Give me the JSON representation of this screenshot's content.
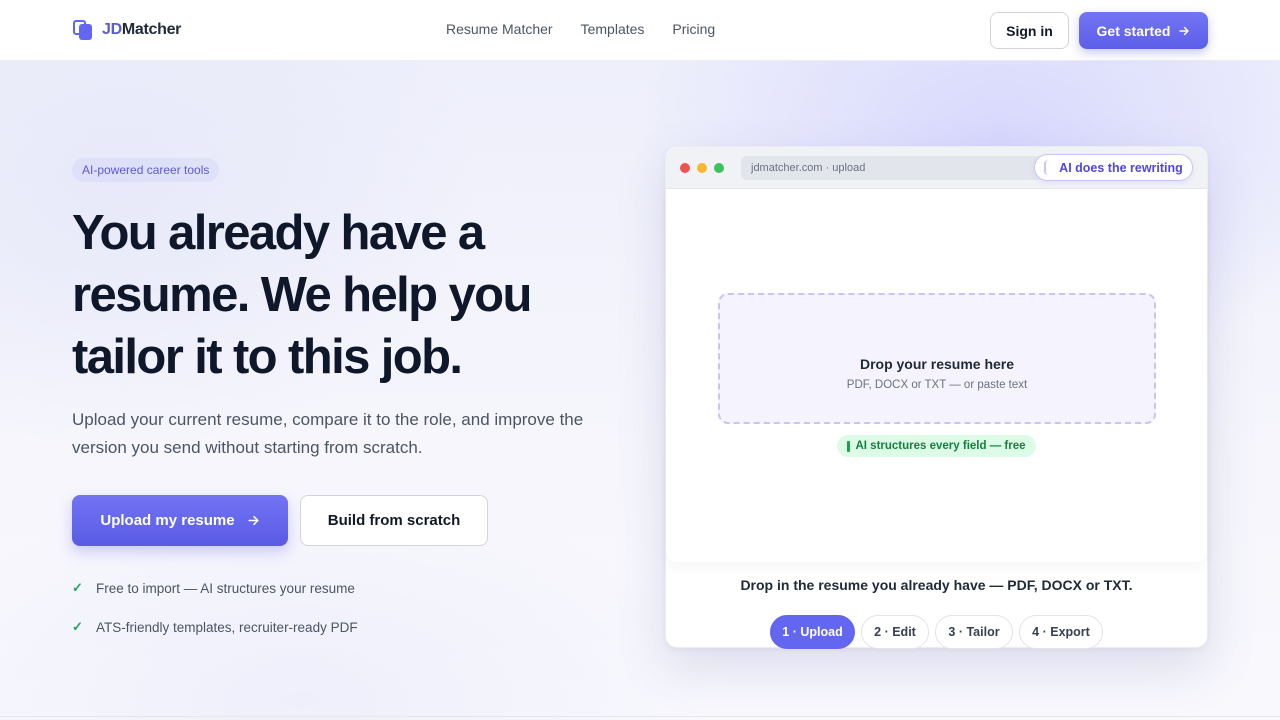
{
  "brand": {
    "prefix": "JD",
    "suffix": "Matcher"
  },
  "nav": {
    "links": [
      "Resume Matcher",
      "Templates",
      "Pricing"
    ],
    "sign_in": "Sign in",
    "get_started": "Get started",
    "get_started_icon": "arrow-right-icon"
  },
  "hero": {
    "badge": "AI-powered career tools",
    "headline": "You already have a resume. We help you tailor it to this job.",
    "subtext": "Upload your current resume, compare it to the role, and improve the version you send without starting from scratch.",
    "primary_button": "Upload my resume",
    "secondary_button": "Build from scratch",
    "checks": [
      "Free to import — AI structures your resume",
      "ATS-friendly templates, recruiter-ready PDF"
    ]
  },
  "mock": {
    "url": "jdmatcher.com · upload",
    "ai_badge": "AI does the rewriting",
    "drop_title": "Drop your resume here",
    "drop_sub": "PDF, DOCX or TXT — or paste text",
    "free_badge": "AI structures every field — free",
    "caption": "Drop in the resume you already have — PDF, DOCX or TXT.",
    "steps": [
      {
        "label": "1 · Upload",
        "active": true
      },
      {
        "label": "2 · Edit",
        "active": false
      },
      {
        "label": "3 · Tailor",
        "active": false
      },
      {
        "label": "4 · Export",
        "active": false
      }
    ]
  },
  "colors": {
    "accent": "#6366f1",
    "success": "#22a55a",
    "heading": "#0f172a"
  }
}
